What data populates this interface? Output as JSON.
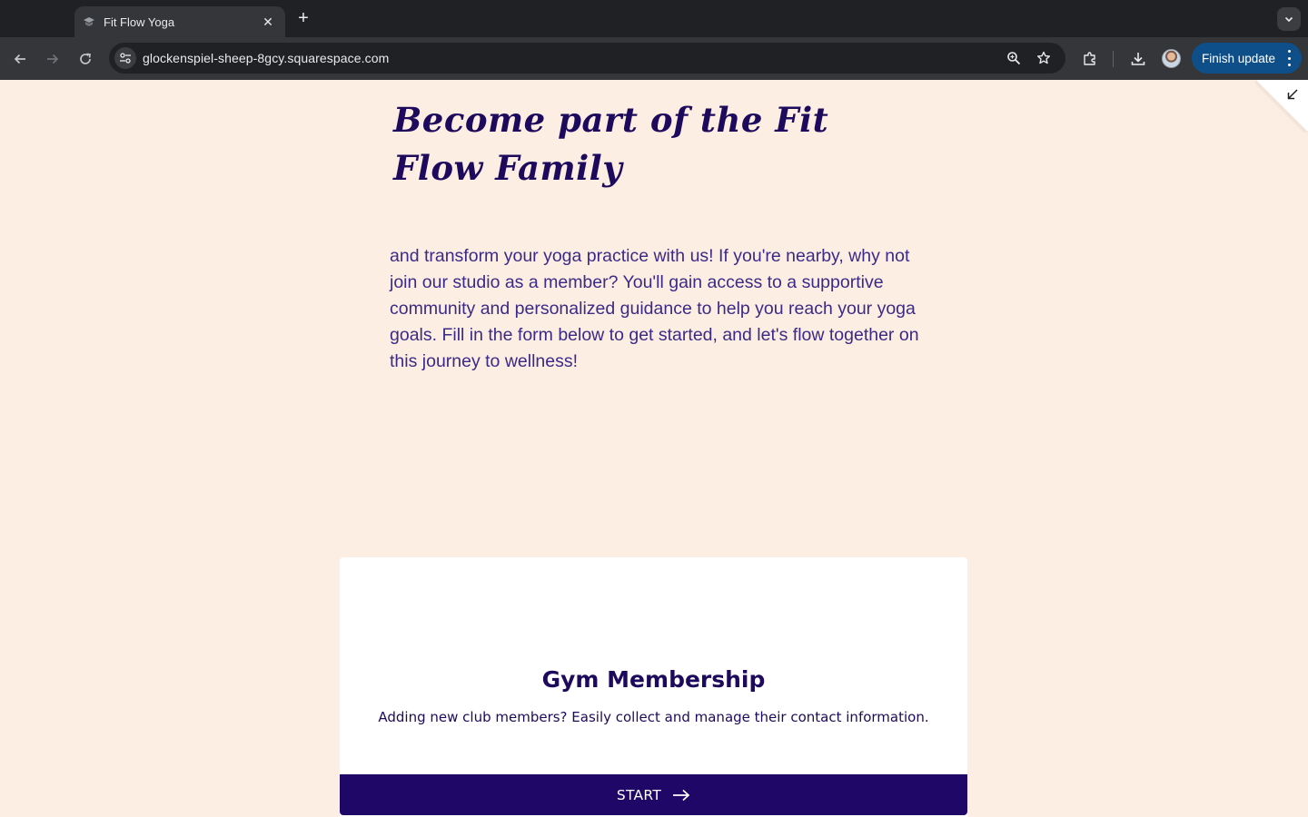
{
  "browser": {
    "tab": {
      "title": "Fit Flow Yoga",
      "favicon": "squarespace-icon"
    },
    "url": "glockenspiel-sheep-8gcy.squarespace.com",
    "finish_update_label": "Finish update",
    "icons": [
      "back-icon",
      "forward-icon",
      "reload-icon",
      "site-info-icon",
      "zoom-icon",
      "bookmark-star-icon",
      "extensions-icon",
      "download-icon",
      "profile-avatar",
      "more-icon"
    ]
  },
  "page": {
    "heading": "Become part of the Fit Flow Family",
    "intro": "and transform your yoga practice with us! If you're nearby, why not join our studio as a member? You'll gain access to a supportive community and personalized guidance to help you reach your yoga goals. Fill in the form below to get started, and let's flow together on this journey to wellness!",
    "form_card": {
      "title": "Gym Membership",
      "description": "Adding new club members? Easily collect and manage their contact information.",
      "start_label": "START"
    }
  },
  "colors": {
    "background": "#fdeee4",
    "heading": "#1e0a5c",
    "body_text": "#3b2a86",
    "button": "#1e0766",
    "finish_update": "#0e4f8a"
  }
}
